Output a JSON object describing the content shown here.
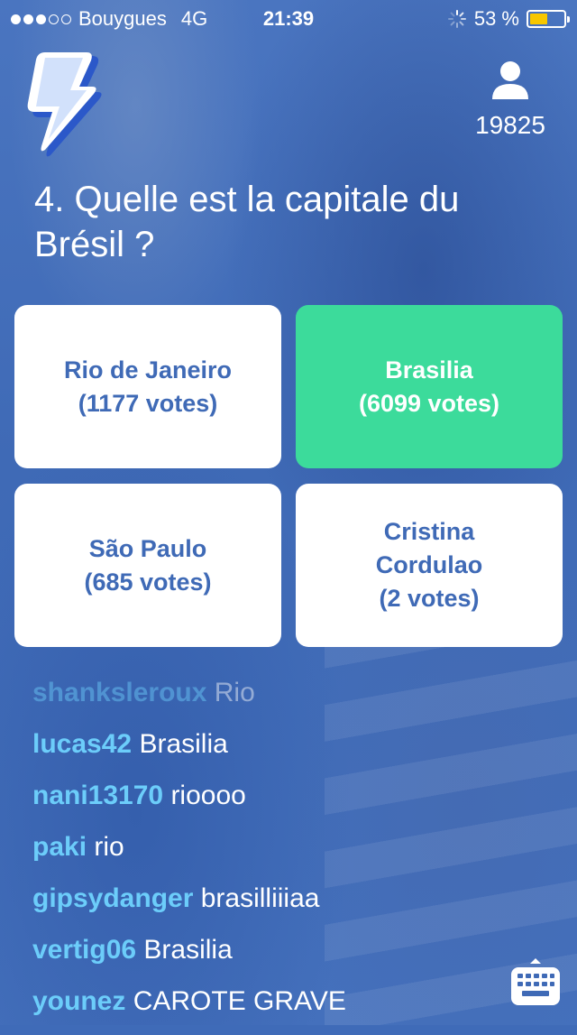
{
  "status_bar": {
    "carrier": "Bouygues",
    "network": "4G",
    "time": "21:39",
    "battery": "53 %",
    "battery_level": 0.53,
    "signal_bars_filled": 3,
    "signal_bars_total": 5
  },
  "header": {
    "logo_icon": "lightning-bolt-icon",
    "viewer_icon": "user-icon",
    "viewer_count": "19825"
  },
  "question": {
    "text": "4. Quelle est la capitale du Brésil ?"
  },
  "answers": [
    {
      "label": "Rio de Janeiro",
      "votes": "(1177 votes)",
      "correct": false
    },
    {
      "label": "Brasilia",
      "votes": "(6099 votes)",
      "correct": true
    },
    {
      "label": "São Paulo",
      "votes": "(685 votes)",
      "correct": false
    },
    {
      "label": "Cristina Cordulao",
      "votes": "(2 votes)",
      "correct": false
    }
  ],
  "chat": [
    {
      "user": "shanksleroux",
      "text": "Rio"
    },
    {
      "user": "lucas42",
      "text": "Brasilia"
    },
    {
      "user": "nani13170",
      "text": "rioooo"
    },
    {
      "user": "paki",
      "text": "rio"
    },
    {
      "user": "gipsydanger",
      "text": "brasilliiiaa"
    },
    {
      "user": "vertig06",
      "text": "Brasilia"
    },
    {
      "user": "younez",
      "text": "CAROTE GRAVE"
    }
  ],
  "colors": {
    "background": "#3f6bb8",
    "correct": "#3cdb9b",
    "answer_text": "#3f6ab6",
    "username": "#6ccdfa"
  },
  "keyboard_button_icon": "keyboard-icon"
}
